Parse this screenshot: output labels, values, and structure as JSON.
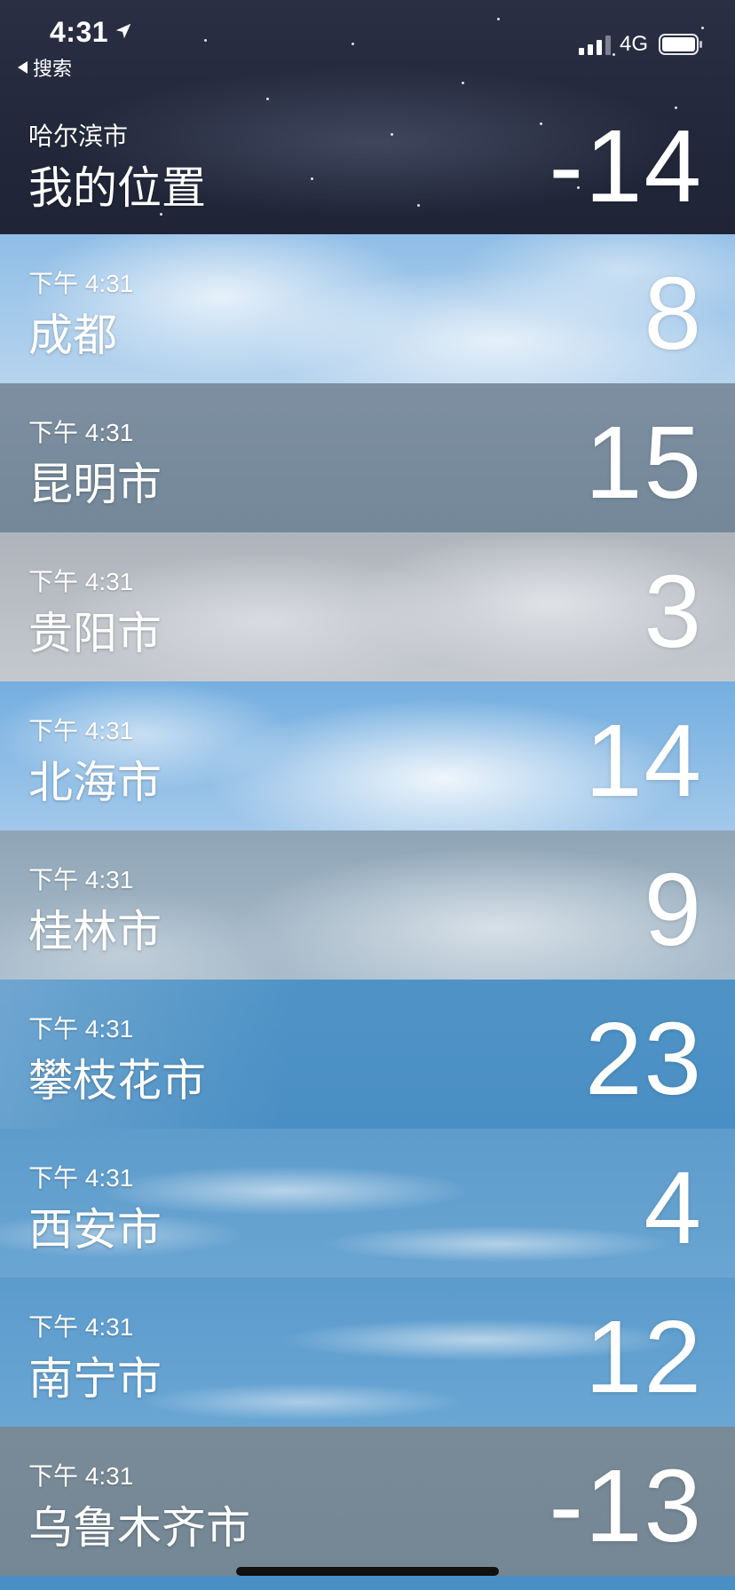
{
  "status_bar": {
    "time": "4:31",
    "back_label": "搜索",
    "network": "4G"
  },
  "rows": [
    {
      "subtitle": "哈尔滨市",
      "city": "我的位置",
      "temp": "-14"
    },
    {
      "subtitle": "下午 4:31",
      "city": "成都",
      "temp": "8"
    },
    {
      "subtitle": "下午 4:31",
      "city": "昆明市",
      "temp": "15"
    },
    {
      "subtitle": "下午 4:31",
      "city": "贵阳市",
      "temp": "3"
    },
    {
      "subtitle": "下午 4:31",
      "city": "北海市",
      "temp": "14"
    },
    {
      "subtitle": "下午 4:31",
      "city": "桂林市",
      "temp": "9"
    },
    {
      "subtitle": "下午 4:31",
      "city": "攀枝花市",
      "temp": "23"
    },
    {
      "subtitle": "下午 4:31",
      "city": "西安市",
      "temp": "4"
    },
    {
      "subtitle": "下午 4:31",
      "city": "南宁市",
      "temp": "12"
    },
    {
      "subtitle": "下午 4:31",
      "city": "乌鲁木齐市",
      "temp": "-13"
    }
  ],
  "icons": {
    "location": "location-arrow-icon",
    "back": "back-arrow-icon",
    "signal": "signal-icon",
    "battery": "battery-icon"
  }
}
